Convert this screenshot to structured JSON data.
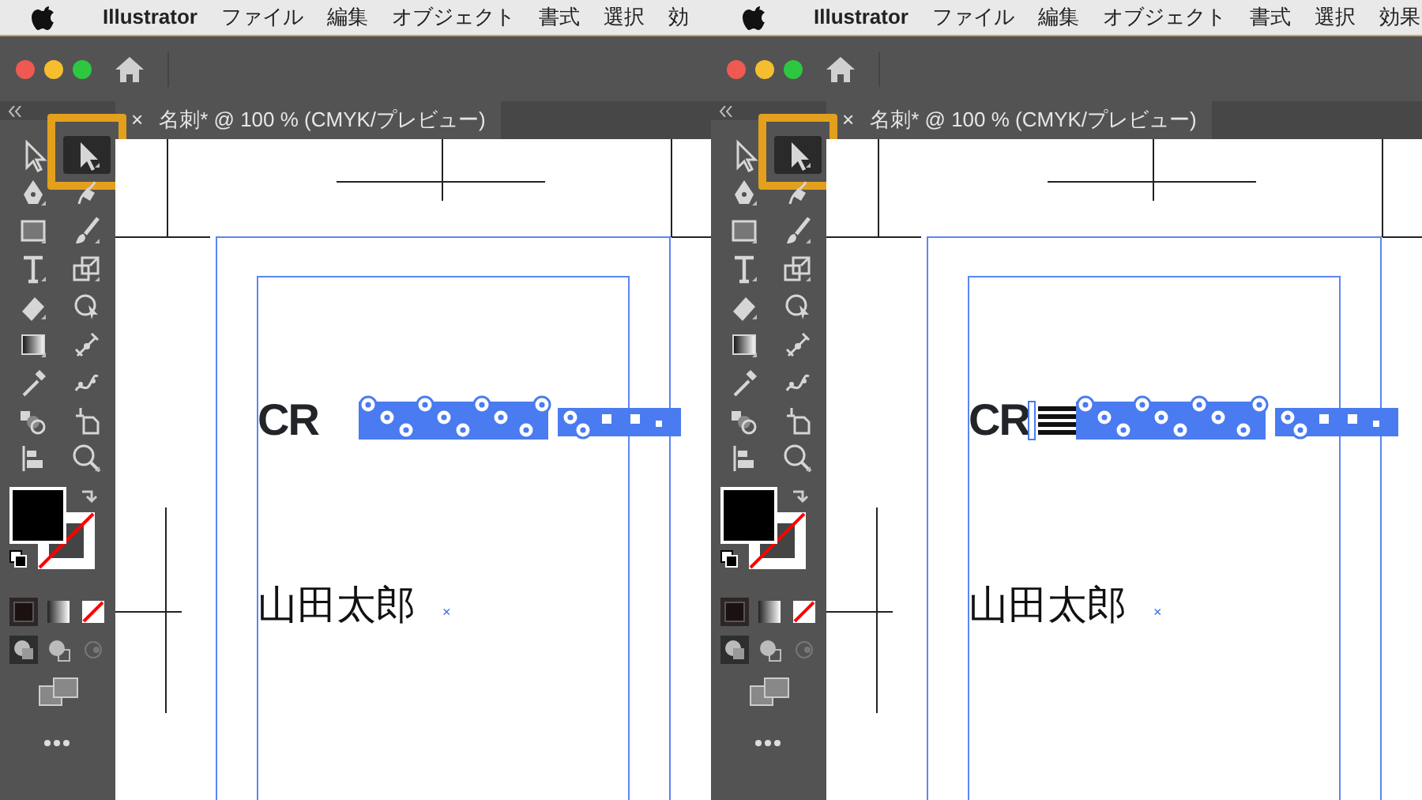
{
  "panels": [
    {
      "menu_bar": {
        "app": "Illustrator",
        "items": [
          "ファイル",
          "編集",
          "オブジェクト",
          "書式",
          "選択",
          "効"
        ]
      },
      "document_tab": {
        "close": "×",
        "title": "名刺* @ 100 % (CMYK/プレビュー)"
      },
      "tools": [
        {
          "kind": "selection",
          "selected": false
        },
        {
          "kind": "direct-selection",
          "selected": true
        },
        {
          "kind": "pen",
          "selected": false
        },
        {
          "kind": "curvature",
          "selected": false
        },
        {
          "kind": "rectangle",
          "selected": false
        },
        {
          "kind": "brush",
          "selected": false
        },
        {
          "kind": "type",
          "selected": false
        },
        {
          "kind": "scale",
          "selected": false
        },
        {
          "kind": "eraser",
          "selected": false
        },
        {
          "kind": "shape-builder",
          "selected": false
        },
        {
          "kind": "gradient",
          "selected": false
        },
        {
          "kind": "width",
          "selected": false
        },
        {
          "kind": "eyedropper",
          "selected": false
        },
        {
          "kind": "puppet",
          "selected": false
        },
        {
          "kind": "blend",
          "selected": false
        },
        {
          "kind": "artboard",
          "selected": false
        },
        {
          "kind": "align",
          "selected": false
        },
        {
          "kind": "zoom",
          "selected": false
        }
      ],
      "canvas": {
        "headline": "CR",
        "stripes_selected": false,
        "name": "山田太郎",
        "anchor": "×"
      }
    },
    {
      "menu_bar": {
        "app": "Illustrator",
        "items": [
          "ファイル",
          "編集",
          "オブジェクト",
          "書式",
          "選択",
          "効果"
        ]
      },
      "document_tab": {
        "close": "×",
        "title": "名刺* @ 100 % (CMYK/プレビュー)"
      },
      "tools": [
        {
          "kind": "selection",
          "selected": false
        },
        {
          "kind": "direct-selection",
          "selected": true
        },
        {
          "kind": "pen",
          "selected": false
        },
        {
          "kind": "curvature",
          "selected": false
        },
        {
          "kind": "rectangle",
          "selected": false
        },
        {
          "kind": "brush",
          "selected": false
        },
        {
          "kind": "type",
          "selected": false
        },
        {
          "kind": "scale",
          "selected": false
        },
        {
          "kind": "eraser",
          "selected": false
        },
        {
          "kind": "shape-builder",
          "selected": false
        },
        {
          "kind": "gradient",
          "selected": false
        },
        {
          "kind": "width",
          "selected": false
        },
        {
          "kind": "eyedropper",
          "selected": false
        },
        {
          "kind": "puppet",
          "selected": false
        },
        {
          "kind": "blend",
          "selected": false
        },
        {
          "kind": "artboard",
          "selected": false
        },
        {
          "kind": "align",
          "selected": false
        },
        {
          "kind": "zoom",
          "selected": false
        }
      ],
      "canvas": {
        "headline": "CR",
        "stripes_selected": true,
        "name": "山田太郎",
        "anchor": "×"
      }
    }
  ]
}
